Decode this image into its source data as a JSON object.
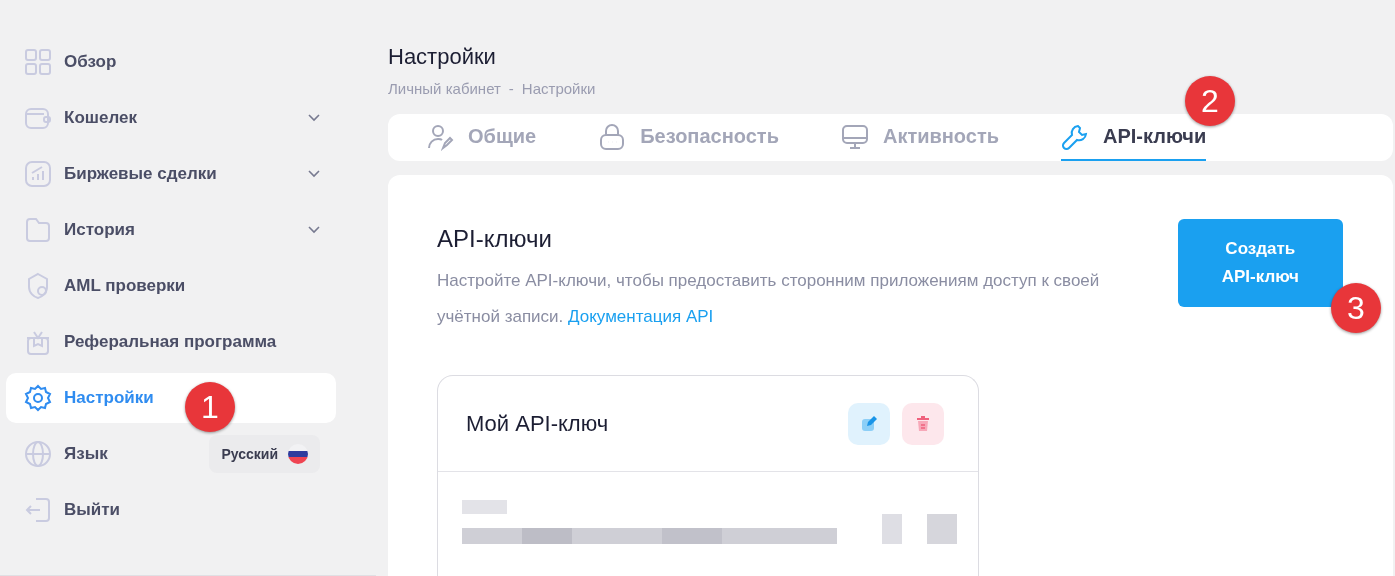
{
  "sidebar": {
    "items": [
      {
        "label": "Обзор",
        "kind": "link",
        "selected": false
      },
      {
        "label": "Кошелек",
        "kind": "group",
        "selected": false
      },
      {
        "label": "Биржевые сделки",
        "kind": "group",
        "selected": false
      },
      {
        "label": "История",
        "kind": "group",
        "selected": false
      },
      {
        "label": "AML проверки",
        "kind": "link",
        "selected": false
      },
      {
        "label": "Реферальная программа",
        "kind": "link",
        "selected": false
      },
      {
        "label": "Настройки",
        "kind": "link",
        "selected": true
      },
      {
        "label": "Язык",
        "kind": "select",
        "selected": false,
        "value": "Русский"
      },
      {
        "label": "Выйти",
        "kind": "link",
        "selected": false
      }
    ]
  },
  "page": {
    "title": "Настройки",
    "breadcrumb": [
      "Личный кабинет",
      "-",
      "Настройки"
    ]
  },
  "tabs": [
    {
      "label": "Общие",
      "selected": false
    },
    {
      "label": "Безопасность",
      "selected": false
    },
    {
      "label": "Активность",
      "selected": false
    },
    {
      "label": "API-ключи",
      "selected": true
    }
  ],
  "api_keys": {
    "title": "API-ключи",
    "description": "Настройте API-ключи, чтобы предоставить сторонним приложениям доступ к своей учётной записи.",
    "doc_link": "Документация API",
    "create_button": "Создать API-ключ",
    "keys": [
      {
        "name": "Мой API-ключ"
      }
    ]
  },
  "callouts": [
    {
      "label": "1"
    },
    {
      "label": "2"
    },
    {
      "label": "3"
    }
  ]
}
